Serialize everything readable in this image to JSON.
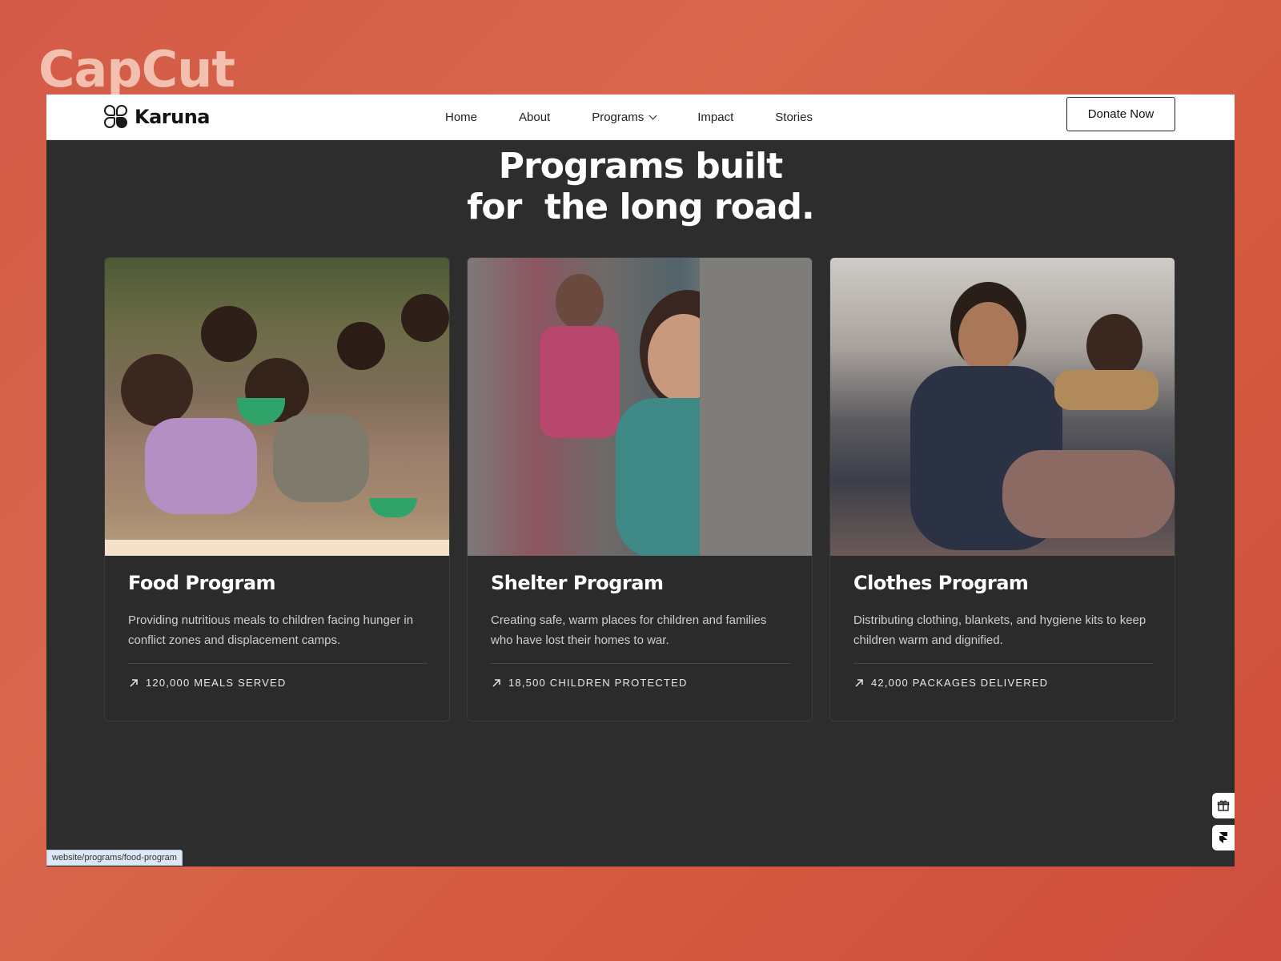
{
  "watermark": "CapCut",
  "nav": {
    "brand": "Karuna",
    "links": [
      "Home",
      "About",
      "Programs",
      "Impact",
      "Stories"
    ],
    "donate_label": "Donate Now"
  },
  "hero": {
    "line1": "Programs built",
    "line2": "for  the long road."
  },
  "programs": [
    {
      "title": "Food Program",
      "description": "Providing nutritious meals to children facing hunger in conflict zones and displacement camps.",
      "stat": "120,000 MEALS SERVED"
    },
    {
      "title": "Shelter Program",
      "description": "Creating safe, warm places for children and families who have lost their homes to war.",
      "stat": "18,500 CHILDREN PROTECTED"
    },
    {
      "title": "Clothes Program",
      "description": "Distributing clothing, blankets, and hygiene kits to keep children warm and dignified.",
      "stat": "42,000 PACKAGES DELIVERED"
    }
  ],
  "status_url": "website/programs/food-program",
  "side_buttons": [
    "gift-icon",
    "framer-icon"
  ],
  "colors": {
    "page_bg": "#2d2d2e",
    "accent_bg": "#d35a47",
    "nav_bg": "#ffffff"
  }
}
